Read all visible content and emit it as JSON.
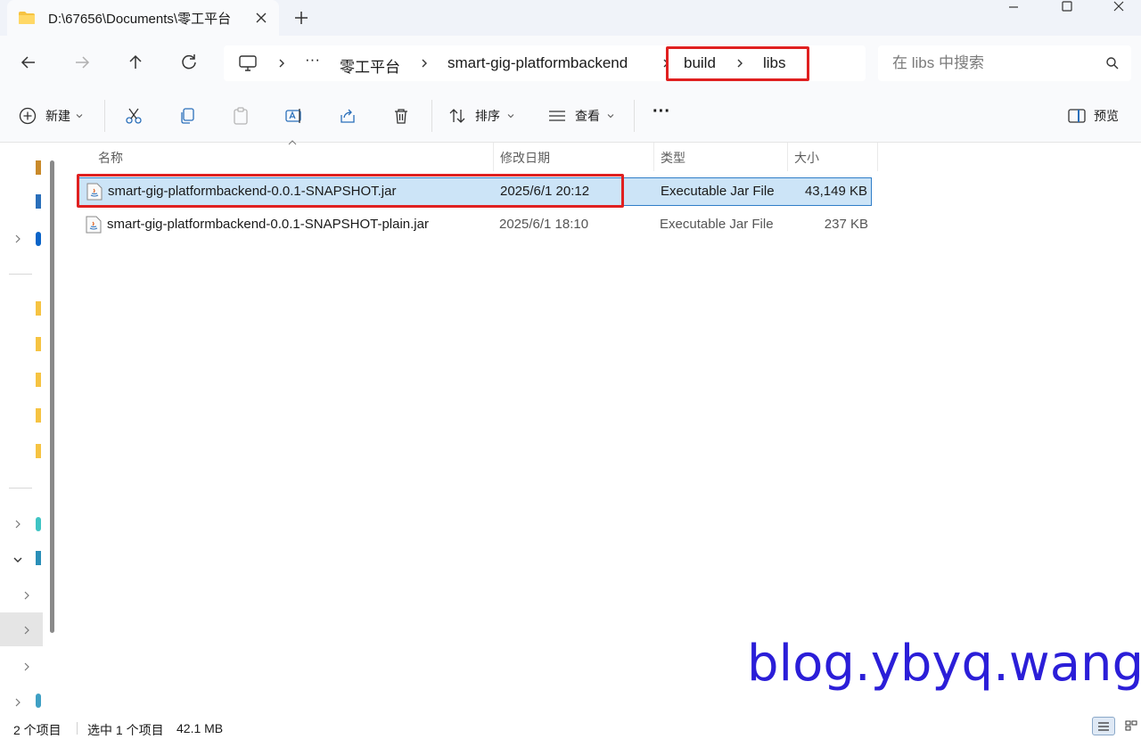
{
  "titlebar": {
    "tab_title": "D:\\67656\\Documents\\零工平台",
    "new_tab_label": "+"
  },
  "breadcrumb": {
    "more": "···",
    "items": [
      "零工平台",
      "smart-gig-platformbackend",
      "build",
      "libs"
    ]
  },
  "search": {
    "placeholder": "在 libs 中搜索"
  },
  "toolbar": {
    "new_label": "新建",
    "sort_label": "排序",
    "view_label": "查看",
    "more_label": "···",
    "preview_label": "预览"
  },
  "columns": {
    "name": "名称",
    "date": "修改日期",
    "type": "类型",
    "size": "大小"
  },
  "files": [
    {
      "name": "smart-gig-platformbackend-0.0.1-SNAPSHOT.jar",
      "date": "2025/6/1 20:12",
      "type": "Executable Jar File",
      "size": "43,149 KB",
      "selected": true
    },
    {
      "name": "smart-gig-platformbackend-0.0.1-SNAPSHOT-plain.jar",
      "date": "2025/6/1 18:10",
      "type": "Executable Jar File",
      "size": "237 KB",
      "selected": false
    }
  ],
  "status": {
    "item_count": "2 个项目",
    "selection": "选中 1 个项目",
    "selection_size": "42.1 MB"
  },
  "watermark": "blog.ybyq.wang",
  "colors": {
    "accent_selected_bg": "#cce4f7",
    "accent_selected_border": "#2f7dc8",
    "highlight_box": "#e02020",
    "watermark": "#2b1ed8",
    "folder": "#f6c342"
  }
}
